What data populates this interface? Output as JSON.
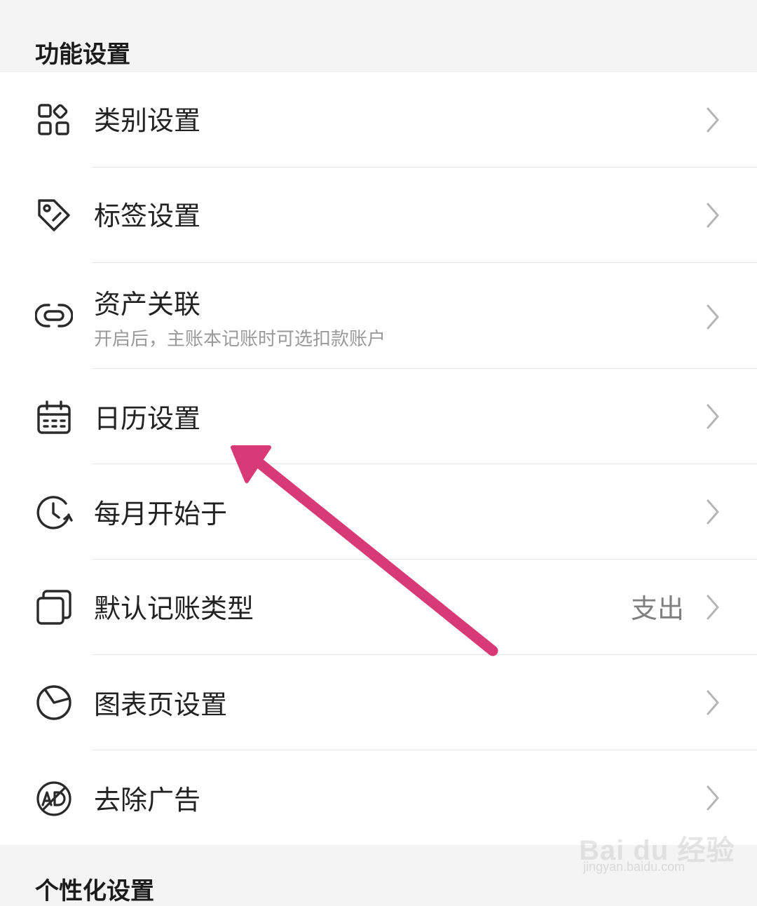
{
  "sections": {
    "features_title": "功能设置",
    "personal_title": "个性化设置"
  },
  "rows": [
    {
      "label": "类别设置",
      "icon": "category-grid-icon"
    },
    {
      "label": "标签设置",
      "icon": "tag-icon"
    },
    {
      "label": "资产关联",
      "sublabel": "开启后，主账本记账时可选扣款账户",
      "icon": "link-icon"
    },
    {
      "label": "日历设置",
      "icon": "calendar-icon"
    },
    {
      "label": "每月开始于",
      "icon": "clock-cycle-icon"
    },
    {
      "label": "默认记账类型",
      "value": "支出",
      "icon": "stacked-cards-icon"
    },
    {
      "label": "图表页设置",
      "icon": "pie-chart-icon"
    },
    {
      "label": "去除广告",
      "icon": "no-ad-icon"
    }
  ],
  "chevron_icon": "chevron-right-icon",
  "annotation": {
    "icon": "pointer-arrow",
    "color": "#d83a78"
  },
  "watermark": {
    "main": "Bai du 经验",
    "url": "jingyan.baidu.com"
  },
  "colors": {
    "background": "#f4f4f5",
    "card": "#ffffff",
    "text": "#222222",
    "subtext": "#9a9a9a",
    "chevron": "#b5b5b5",
    "arrow": "#d83a78"
  }
}
